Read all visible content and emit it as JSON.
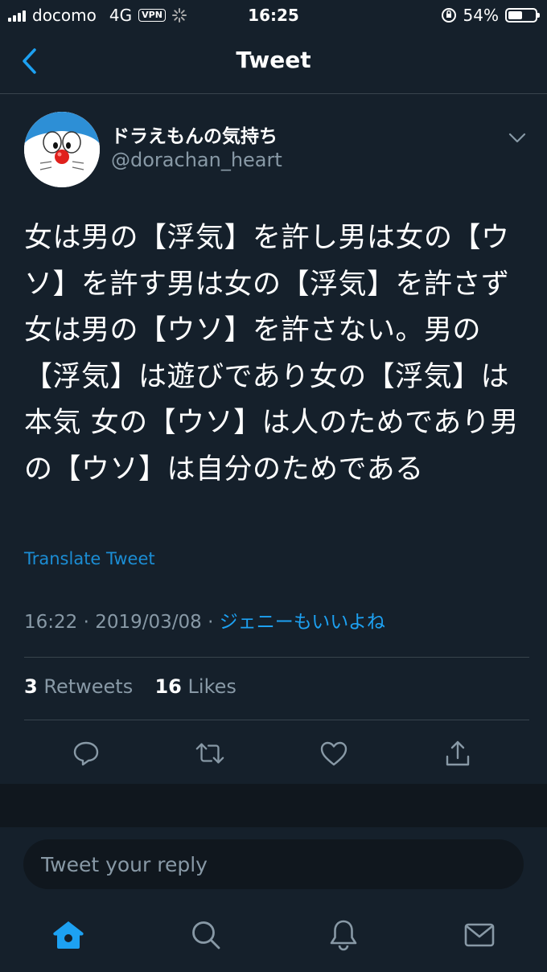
{
  "status_bar": {
    "carrier": "docomo",
    "network": "4G",
    "vpn": "VPN",
    "time": "16:25",
    "battery": "54%",
    "battery_level": 0.54
  },
  "header": {
    "title": "Tweet",
    "back_icon": "chevron-left-icon"
  },
  "tweet": {
    "display_name": "ドラえもんの気持ち",
    "handle": "@dorachan_heart",
    "text": "女は男の【浮気】を許し男は女の【ウソ】を許す男は女の【浮気】を許さず女は男の【ウソ】を許さない。男の【浮気】は遊びであり女の【浮気】は本気 女の【ウソ】は人のためであり男の【ウソ】は自分のためである",
    "translate_label": "Translate Tweet",
    "time": "16:22",
    "separator": " · ",
    "date": "2019/03/08",
    "source": "ジェニーもいいよね",
    "retweets_count": "3",
    "retweets_label": "Retweets",
    "likes_count": "16",
    "likes_label": "Likes"
  },
  "actions": [
    "reply-icon",
    "retweet-icon",
    "like-icon",
    "share-icon"
  ],
  "reply": {
    "placeholder": "Tweet your reply"
  },
  "tabs": [
    "home-icon",
    "search-icon",
    "notifications-icon",
    "messages-icon"
  ],
  "colors": {
    "background": "#15202b",
    "accent": "#1da1f2",
    "secondary_text": "#8899a6",
    "divider": "#38444d"
  }
}
